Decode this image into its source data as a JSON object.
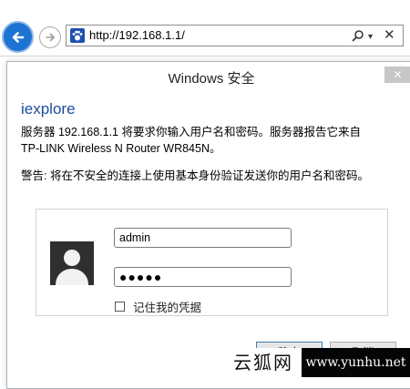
{
  "browser": {
    "url": "http://192.168.1.1/",
    "back_icon": "back-arrow-icon",
    "forward_icon": "forward-arrow-icon",
    "favicon_icon": "tplink-paw-icon",
    "address_controls": {
      "search": "search-icon",
      "dropdown": "▾",
      "close": "✕"
    }
  },
  "dialog": {
    "title": "Windows 安全",
    "close_symbol": "✕",
    "app_name": "iexplore",
    "message_line1": "服务器 192.168.1.1 将要求你输入用户名和密码。服务器报告它来自",
    "message_line2": "TP-LINK Wireless N Router WR845N。",
    "warning": "警告: 将在不安全的连接上使用基本身份验证发送你的用户名和密码。",
    "username_value": "admin",
    "password_value": "●●●●●",
    "remember_label": "记住我的凭据",
    "remember_checked": false,
    "ok_label": "确定",
    "cancel_label": "取消"
  },
  "watermark": {
    "left_text": "云狐网",
    "right_text": "www.yunhu.net"
  },
  "colors": {
    "accent": "#1e73d2",
    "app_name": "#1a4b9c",
    "favicon": "#1f4fb0"
  }
}
